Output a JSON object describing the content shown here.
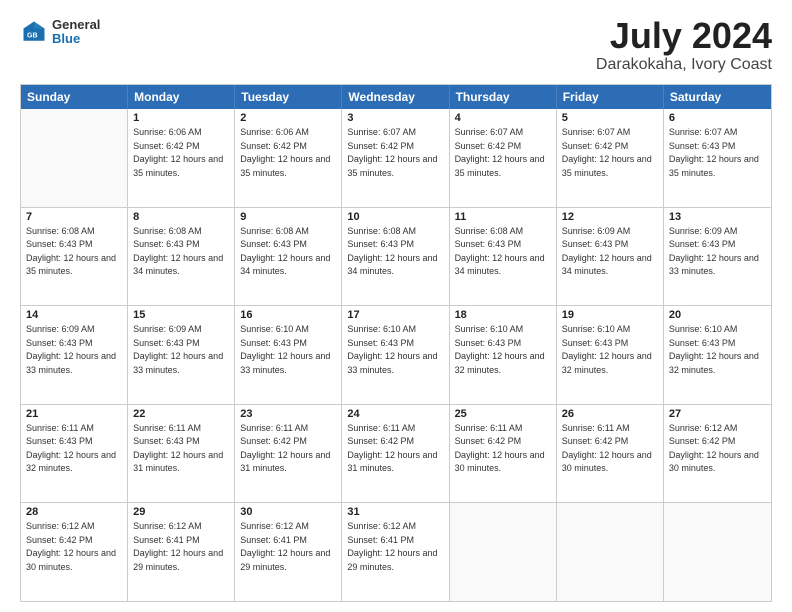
{
  "header": {
    "logo": {
      "line1": "General",
      "line2": "Blue"
    },
    "title": "July 2024",
    "location": "Darakokaha, Ivory Coast"
  },
  "weekdays": [
    "Sunday",
    "Monday",
    "Tuesday",
    "Wednesday",
    "Thursday",
    "Friday",
    "Saturday"
  ],
  "weeks": [
    [
      {
        "day": "",
        "empty": true
      },
      {
        "day": "1",
        "sunrise": "Sunrise: 6:06 AM",
        "sunset": "Sunset: 6:42 PM",
        "daylight": "Daylight: 12 hours and 35 minutes."
      },
      {
        "day": "2",
        "sunrise": "Sunrise: 6:06 AM",
        "sunset": "Sunset: 6:42 PM",
        "daylight": "Daylight: 12 hours and 35 minutes."
      },
      {
        "day": "3",
        "sunrise": "Sunrise: 6:07 AM",
        "sunset": "Sunset: 6:42 PM",
        "daylight": "Daylight: 12 hours and 35 minutes."
      },
      {
        "day": "4",
        "sunrise": "Sunrise: 6:07 AM",
        "sunset": "Sunset: 6:42 PM",
        "daylight": "Daylight: 12 hours and 35 minutes."
      },
      {
        "day": "5",
        "sunrise": "Sunrise: 6:07 AM",
        "sunset": "Sunset: 6:42 PM",
        "daylight": "Daylight: 12 hours and 35 minutes."
      },
      {
        "day": "6",
        "sunrise": "Sunrise: 6:07 AM",
        "sunset": "Sunset: 6:43 PM",
        "daylight": "Daylight: 12 hours and 35 minutes."
      }
    ],
    [
      {
        "day": "7",
        "sunrise": "Sunrise: 6:08 AM",
        "sunset": "Sunset: 6:43 PM",
        "daylight": "Daylight: 12 hours and 35 minutes."
      },
      {
        "day": "8",
        "sunrise": "Sunrise: 6:08 AM",
        "sunset": "Sunset: 6:43 PM",
        "daylight": "Daylight: 12 hours and 34 minutes."
      },
      {
        "day": "9",
        "sunrise": "Sunrise: 6:08 AM",
        "sunset": "Sunset: 6:43 PM",
        "daylight": "Daylight: 12 hours and 34 minutes."
      },
      {
        "day": "10",
        "sunrise": "Sunrise: 6:08 AM",
        "sunset": "Sunset: 6:43 PM",
        "daylight": "Daylight: 12 hours and 34 minutes."
      },
      {
        "day": "11",
        "sunrise": "Sunrise: 6:08 AM",
        "sunset": "Sunset: 6:43 PM",
        "daylight": "Daylight: 12 hours and 34 minutes."
      },
      {
        "day": "12",
        "sunrise": "Sunrise: 6:09 AM",
        "sunset": "Sunset: 6:43 PM",
        "daylight": "Daylight: 12 hours and 34 minutes."
      },
      {
        "day": "13",
        "sunrise": "Sunrise: 6:09 AM",
        "sunset": "Sunset: 6:43 PM",
        "daylight": "Daylight: 12 hours and 33 minutes."
      }
    ],
    [
      {
        "day": "14",
        "sunrise": "Sunrise: 6:09 AM",
        "sunset": "Sunset: 6:43 PM",
        "daylight": "Daylight: 12 hours and 33 minutes."
      },
      {
        "day": "15",
        "sunrise": "Sunrise: 6:09 AM",
        "sunset": "Sunset: 6:43 PM",
        "daylight": "Daylight: 12 hours and 33 minutes."
      },
      {
        "day": "16",
        "sunrise": "Sunrise: 6:10 AM",
        "sunset": "Sunset: 6:43 PM",
        "daylight": "Daylight: 12 hours and 33 minutes."
      },
      {
        "day": "17",
        "sunrise": "Sunrise: 6:10 AM",
        "sunset": "Sunset: 6:43 PM",
        "daylight": "Daylight: 12 hours and 33 minutes."
      },
      {
        "day": "18",
        "sunrise": "Sunrise: 6:10 AM",
        "sunset": "Sunset: 6:43 PM",
        "daylight": "Daylight: 12 hours and 32 minutes."
      },
      {
        "day": "19",
        "sunrise": "Sunrise: 6:10 AM",
        "sunset": "Sunset: 6:43 PM",
        "daylight": "Daylight: 12 hours and 32 minutes."
      },
      {
        "day": "20",
        "sunrise": "Sunrise: 6:10 AM",
        "sunset": "Sunset: 6:43 PM",
        "daylight": "Daylight: 12 hours and 32 minutes."
      }
    ],
    [
      {
        "day": "21",
        "sunrise": "Sunrise: 6:11 AM",
        "sunset": "Sunset: 6:43 PM",
        "daylight": "Daylight: 12 hours and 32 minutes."
      },
      {
        "day": "22",
        "sunrise": "Sunrise: 6:11 AM",
        "sunset": "Sunset: 6:43 PM",
        "daylight": "Daylight: 12 hours and 31 minutes."
      },
      {
        "day": "23",
        "sunrise": "Sunrise: 6:11 AM",
        "sunset": "Sunset: 6:42 PM",
        "daylight": "Daylight: 12 hours and 31 minutes."
      },
      {
        "day": "24",
        "sunrise": "Sunrise: 6:11 AM",
        "sunset": "Sunset: 6:42 PM",
        "daylight": "Daylight: 12 hours and 31 minutes."
      },
      {
        "day": "25",
        "sunrise": "Sunrise: 6:11 AM",
        "sunset": "Sunset: 6:42 PM",
        "daylight": "Daylight: 12 hours and 30 minutes."
      },
      {
        "day": "26",
        "sunrise": "Sunrise: 6:11 AM",
        "sunset": "Sunset: 6:42 PM",
        "daylight": "Daylight: 12 hours and 30 minutes."
      },
      {
        "day": "27",
        "sunrise": "Sunrise: 6:12 AM",
        "sunset": "Sunset: 6:42 PM",
        "daylight": "Daylight: 12 hours and 30 minutes."
      }
    ],
    [
      {
        "day": "28",
        "sunrise": "Sunrise: 6:12 AM",
        "sunset": "Sunset: 6:42 PM",
        "daylight": "Daylight: 12 hours and 30 minutes."
      },
      {
        "day": "29",
        "sunrise": "Sunrise: 6:12 AM",
        "sunset": "Sunset: 6:41 PM",
        "daylight": "Daylight: 12 hours and 29 minutes."
      },
      {
        "day": "30",
        "sunrise": "Sunrise: 6:12 AM",
        "sunset": "Sunset: 6:41 PM",
        "daylight": "Daylight: 12 hours and 29 minutes."
      },
      {
        "day": "31",
        "sunrise": "Sunrise: 6:12 AM",
        "sunset": "Sunset: 6:41 PM",
        "daylight": "Daylight: 12 hours and 29 minutes."
      },
      {
        "day": "",
        "empty": true
      },
      {
        "day": "",
        "empty": true
      },
      {
        "day": "",
        "empty": true
      }
    ]
  ]
}
